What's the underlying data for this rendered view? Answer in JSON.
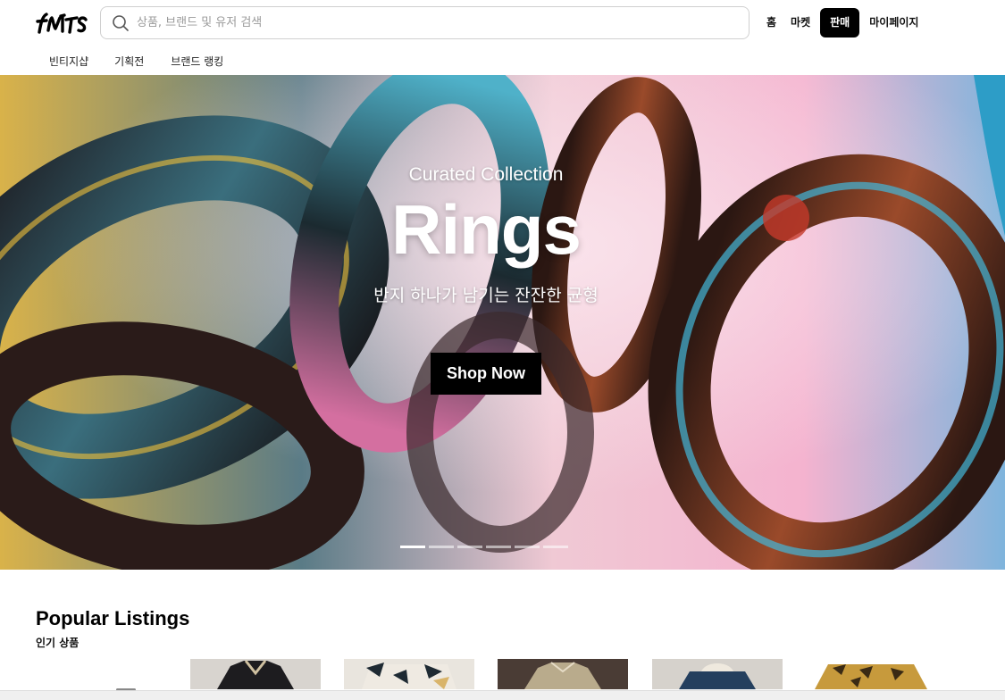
{
  "header": {
    "logo_text": "fruits",
    "search_placeholder": "상품, 브랜드 및 유저 검색",
    "nav": [
      {
        "label": "홈",
        "active": false
      },
      {
        "label": "마켓",
        "active": false
      },
      {
        "label": "판매",
        "active": true
      },
      {
        "label": "마이페이지",
        "active": false
      }
    ]
  },
  "subnav": [
    "빈티지샵",
    "기획전",
    "브랜드 랭킹"
  ],
  "hero": {
    "overline": "Curated Collection",
    "title": "Rings",
    "subtitle": "반지 하나가 남기는 잔잔한 균형",
    "cta": "Shop Now",
    "slide_count": 6,
    "active_slide": 1
  },
  "popular": {
    "title": "Popular Listings",
    "subtitle": "인기 상품"
  },
  "icons": [
    "search-icon"
  ],
  "colors": {
    "accent": "#000000",
    "text": "#111111",
    "border": "#d0d0d0"
  }
}
